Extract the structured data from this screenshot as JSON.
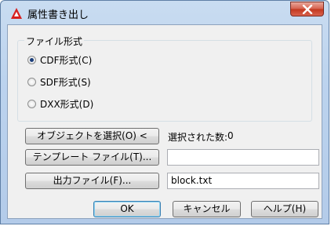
{
  "window": {
    "title": "属性書き出し",
    "app_icon": "autocad-a-icon",
    "close_icon": "close-x-icon"
  },
  "file_format": {
    "group_label": "ファイル形式",
    "options": [
      {
        "label": "CDF形式(C)",
        "checked": true
      },
      {
        "label": "SDF形式(S)",
        "checked": false
      },
      {
        "label": "DXX形式(D)",
        "checked": false
      }
    ]
  },
  "select_objects": {
    "button_label": "オブジェクトを選択(O) <",
    "count_label": "選択された数:",
    "count_value": "0"
  },
  "template_file": {
    "button_label": "テンプレート ファイル(T)...",
    "value": ""
  },
  "output_file": {
    "button_label": "出力ファイル(F)...",
    "value": "block.txt"
  },
  "footer": {
    "ok_label": "OK",
    "cancel_label": "キャンセル",
    "help_label": "ヘルプ(H)"
  },
  "colors": {
    "title_gradient": "#c9dcf1",
    "close_button": "#c2381f",
    "client_bg": "#f0f0f0",
    "default_button_border": "#3c7fb1"
  }
}
